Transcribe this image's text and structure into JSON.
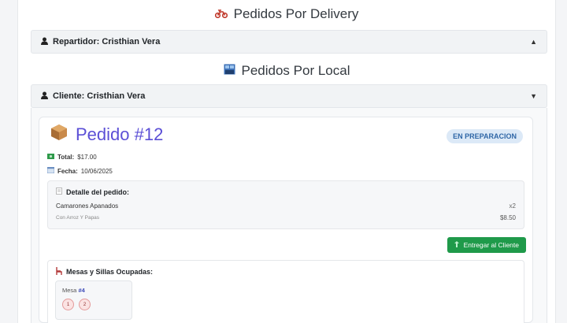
{
  "delivery_section": {
    "icon": "🏍",
    "title": "Pedidos Por Delivery"
  },
  "delivery_accordion": {
    "label": "Repartidor: Cristhian Vera",
    "chevron": "▲"
  },
  "local_section": {
    "icon": "🏬",
    "title": "Pedidos Por Local"
  },
  "local_accordion": {
    "label": "Cliente: Cristhian Vera",
    "chevron": "▼"
  },
  "order": {
    "icon": "📦",
    "title": "Pedido #12",
    "status": "EN PREPARACION",
    "total_label": "Total:",
    "total_value": "$17.00",
    "date_label": "Fecha:",
    "date_value": "10/06/2025",
    "detail_title": "Detalle del pedido:",
    "item": {
      "name": "Camarones Apanados",
      "description": "Con Arroz Y Papas",
      "qty": "x2",
      "price": "$8.50"
    },
    "deliver_button": "Entregar al Cliente",
    "tables_title": "Mesas y Sillas Ocupadas:",
    "mesa": {
      "label": "Mesa ",
      "number": "#4",
      "chairs": [
        "1",
        "2"
      ]
    }
  },
  "colors": {
    "accent": "#5b4fd6",
    "success": "#1f9a4a",
    "badge_bg": "#dce9f7",
    "badge_text": "#2f66a6"
  }
}
